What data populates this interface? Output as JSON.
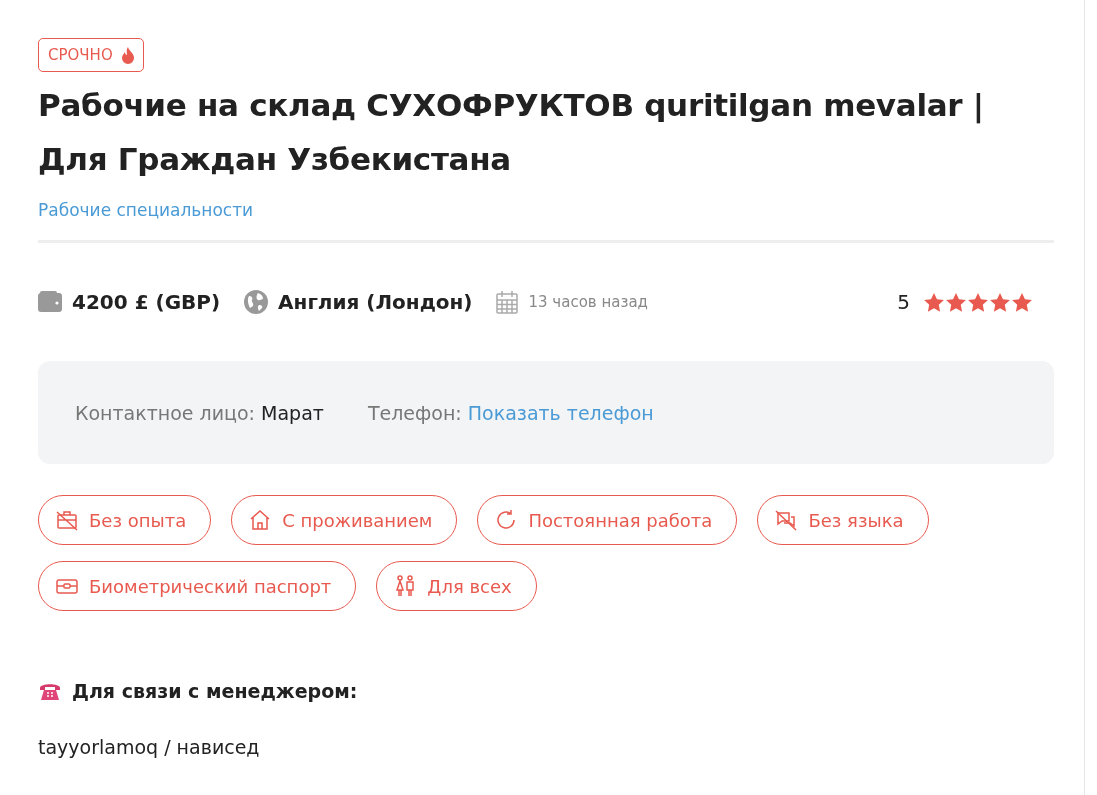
{
  "badge": {
    "label": "СРОЧНО"
  },
  "title": "Рабочие на склад СУХОФРУКТОВ quritilgan mevalar | Для Граждан Узбекистана",
  "category": "Рабочие специальности",
  "info": {
    "salary": "4200 £ (GBP)",
    "location": "Англия (Лондон)",
    "posted": "13 часов назад",
    "rating": "5",
    "stars": 5
  },
  "contact": {
    "person_label": "Контактное лицо:",
    "person": "Марат",
    "phone_label": "Телефон:",
    "phone_link": "Показать телефон"
  },
  "tags": [
    {
      "kind": "no-experience",
      "label": "Без опыта"
    },
    {
      "kind": "housing",
      "label": "С проживанием"
    },
    {
      "kind": "permanent",
      "label": "Постоянная работа"
    },
    {
      "kind": "no-language",
      "label": "Без языка"
    },
    {
      "kind": "passport",
      "label": "Биометрический паспорт"
    },
    {
      "kind": "everyone",
      "label": "Для всех"
    }
  ],
  "manager": {
    "heading": "Для связи с менеджером:",
    "text": "tayyorlamoq / нависед"
  }
}
